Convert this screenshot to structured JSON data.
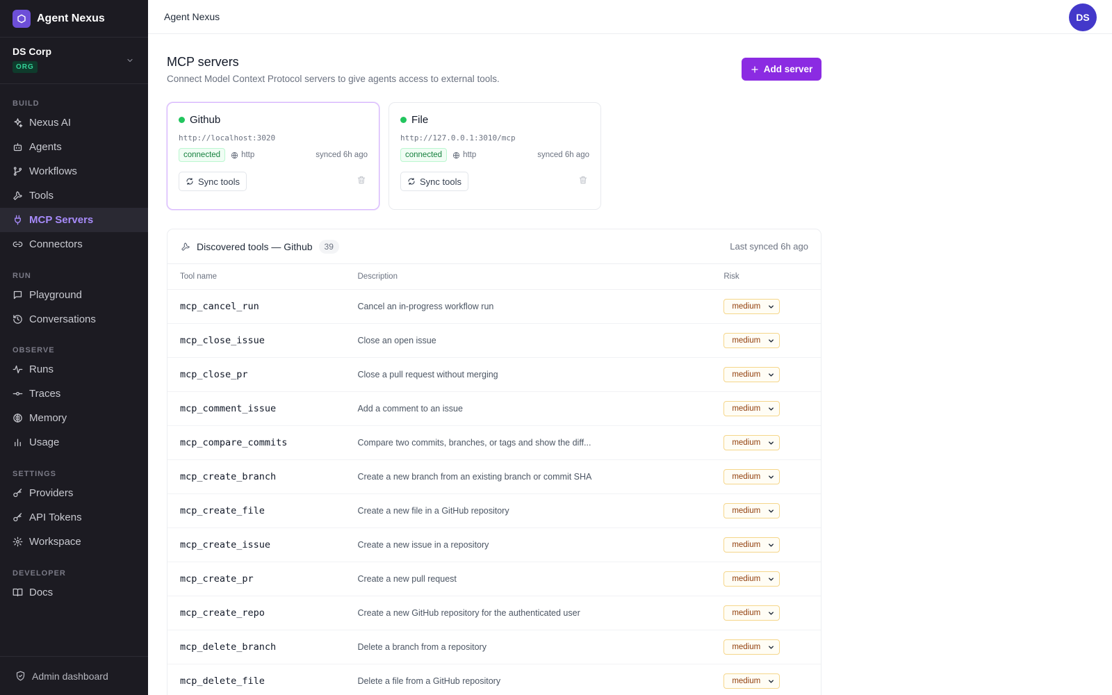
{
  "app": {
    "name": "Agent Nexus"
  },
  "org": {
    "name": "DS Corp",
    "badge": "ORG"
  },
  "sidebar": {
    "sections": [
      {
        "label": "BUILD",
        "items": [
          {
            "label": "Nexus AI",
            "icon": "sparkles-icon"
          },
          {
            "label": "Agents",
            "icon": "bot-icon"
          },
          {
            "label": "Workflows",
            "icon": "workflow-icon"
          },
          {
            "label": "Tools",
            "icon": "wrench-icon"
          },
          {
            "label": "MCP Servers",
            "icon": "plug-icon",
            "active": true
          },
          {
            "label": "Connectors",
            "icon": "link-icon"
          }
        ]
      },
      {
        "label": "RUN",
        "items": [
          {
            "label": "Playground",
            "icon": "chat-icon"
          },
          {
            "label": "Conversations",
            "icon": "history-icon"
          }
        ]
      },
      {
        "label": "OBSERVE",
        "items": [
          {
            "label": "Runs",
            "icon": "activity-icon"
          },
          {
            "label": "Traces",
            "icon": "commit-icon"
          },
          {
            "label": "Memory",
            "icon": "brain-icon"
          },
          {
            "label": "Usage",
            "icon": "bar-chart-icon"
          }
        ]
      },
      {
        "label": "SETTINGS",
        "items": [
          {
            "label": "Providers",
            "icon": "key-icon"
          },
          {
            "label": "API Tokens",
            "icon": "key-icon"
          },
          {
            "label": "Workspace",
            "icon": "gear-icon"
          }
        ]
      },
      {
        "label": "DEVELOPER",
        "items": [
          {
            "label": "Docs",
            "icon": "book-icon"
          }
        ]
      }
    ],
    "footer": "Admin dashboard"
  },
  "header": {
    "title": "Agent Nexus",
    "avatar": "DS"
  },
  "page": {
    "title": "MCP servers",
    "subtitle": "Connect Model Context Protocol servers to give agents access to external tools.",
    "add_button": "Add server"
  },
  "servers": [
    {
      "name": "Github",
      "url": "http://localhost:3020",
      "status": "connected",
      "protocol": "http",
      "synced": "synced 6h ago",
      "sync_label": "Sync tools",
      "selected": true
    },
    {
      "name": "File",
      "url": "http://127.0.0.1:3010/mcp",
      "status": "connected",
      "protocol": "http",
      "synced": "synced 6h ago",
      "sync_label": "Sync tools",
      "selected": false
    }
  ],
  "tools": {
    "title": "Discovered tools — Github",
    "count": "39",
    "last_synced": "Last synced 6h ago",
    "columns": [
      "Tool name",
      "Description",
      "Risk"
    ],
    "rows": [
      {
        "name": "mcp_cancel_run",
        "description": "Cancel an in-progress workflow run",
        "risk": "medium"
      },
      {
        "name": "mcp_close_issue",
        "description": "Close an open issue",
        "risk": "medium"
      },
      {
        "name": "mcp_close_pr",
        "description": "Close a pull request without merging",
        "risk": "medium"
      },
      {
        "name": "mcp_comment_issue",
        "description": "Add a comment to an issue",
        "risk": "medium"
      },
      {
        "name": "mcp_compare_commits",
        "description": "Compare two commits, branches, or tags and show the diff...",
        "risk": "medium"
      },
      {
        "name": "mcp_create_branch",
        "description": "Create a new branch from an existing branch or commit SHA",
        "risk": "medium"
      },
      {
        "name": "mcp_create_file",
        "description": "Create a new file in a GitHub repository",
        "risk": "medium"
      },
      {
        "name": "mcp_create_issue",
        "description": "Create a new issue in a repository",
        "risk": "medium"
      },
      {
        "name": "mcp_create_pr",
        "description": "Create a new pull request",
        "risk": "medium"
      },
      {
        "name": "mcp_create_repo",
        "description": "Create a new GitHub repository for the authenticated user",
        "risk": "medium"
      },
      {
        "name": "mcp_delete_branch",
        "description": "Delete a branch from a repository",
        "risk": "medium"
      },
      {
        "name": "mcp_delete_file",
        "description": "Delete a file from a GitHub repository",
        "risk": "medium"
      }
    ]
  },
  "colors": {
    "accent": "#8b2be2",
    "sidebar_bg": "#1c1b22",
    "active_nav": "#a78bfa",
    "status_ok": "#22c55e",
    "avatar_bg": "#4338ca"
  }
}
